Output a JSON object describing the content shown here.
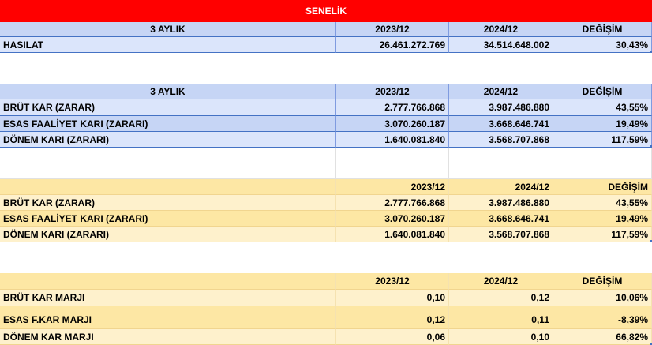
{
  "title": "SENELİK",
  "table1": {
    "header": [
      "3 AYLIK",
      "2023/12",
      "2024/12",
      "DEĞİŞİM"
    ],
    "rows": [
      [
        "HASILAT",
        "26.461.272.769",
        "34.514.648.002",
        "30,43%"
      ]
    ]
  },
  "table2": {
    "header": [
      "3 AYLIK",
      "2023/12",
      "2024/12",
      "DEĞİŞİM"
    ],
    "rows": [
      [
        "BRÜT KAR (ZARAR)",
        "2.777.766.868",
        "3.987.486.880",
        "43,55%"
      ],
      [
        "ESAS FAALİYET KARI (ZARARI)",
        "3.070.260.187",
        "3.668.646.741",
        "19,49%"
      ],
      [
        "DÖNEM KARI (ZARARI)",
        "1.640.081.840",
        "3.568.707.868",
        "117,59%"
      ]
    ]
  },
  "table3": {
    "header": [
      "",
      "2023/12",
      "2024/12",
      "DEĞİŞİM"
    ],
    "rows": [
      [
        "BRÜT KAR (ZARAR)",
        "2.777.766.868",
        "3.987.486.880",
        "43,55%"
      ],
      [
        "ESAS FAALİYET KARI (ZARARI)",
        "3.070.260.187",
        "3.668.646.741",
        "19,49%"
      ],
      [
        "DÖNEM KARI (ZARARI)",
        "1.640.081.840",
        "3.568.707.868",
        "117,59%"
      ]
    ]
  },
  "table4": {
    "header": [
      "",
      "2023/12",
      "2024/12",
      "DEĞİŞİM"
    ],
    "rows": [
      [
        "BRÜT KAR MARJI",
        "0,10",
        "0,12",
        "10,06%"
      ],
      [
        "ESAS F.KAR MARJI",
        "0,12",
        "0,11",
        "-8,39%"
      ],
      [
        "DÖNEM KAR MARJI",
        "0,06",
        "0,10",
        "66,82%"
      ]
    ]
  },
  "colors": {
    "title_bg": "#ff0000",
    "blue_header": "#c6d5f5",
    "blue_row": "#dbe5fb",
    "gold_header": "#fde7a4",
    "gold_row": "#fef1cc"
  }
}
